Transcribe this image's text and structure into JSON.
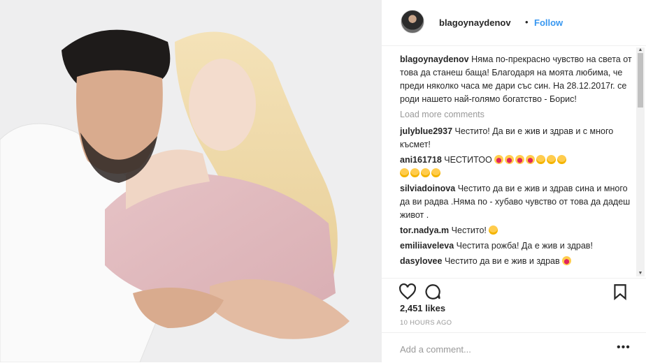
{
  "header": {
    "username": "blagoynaydenov",
    "separator": "•",
    "follow_label": "Follow"
  },
  "caption": {
    "username": "blagoynaydenov",
    "text": "Няма по-прекрасно чувство на света от това да станеш баща! Благодаря на моята любима, че преди няколко часа ме дари със син. На 28.12.2017г. се роди нашето най-голямо богатство - Борис!"
  },
  "load_more": "Load more comments",
  "comments": [
    {
      "username": "julyblue2937",
      "text": "Честито! Да ви е жив и здрав и с много късмет!"
    },
    {
      "username": "ani161718",
      "text": "ЧЕСТИТОО",
      "emoji": [
        "heart-eyes",
        "heart-eyes",
        "heart-eyes",
        "heart-eyes",
        "smiley",
        "smiley",
        "smiley",
        "smiley",
        "smiley",
        "smiley",
        "smiley"
      ]
    },
    {
      "username": "silviadoinova",
      "text": "Честито да ви е жив и здрав сина и много да ви радва .Няма по - хубаво чувство от това да дадеш живот ."
    },
    {
      "username": "tor.nadya.m",
      "text": "Честито!",
      "emoji": [
        "hugging"
      ]
    },
    {
      "username": "emiliiaveleva",
      "text": "Честита рожба! Да е жив и здрав!"
    },
    {
      "username": "dasylovee",
      "text": "Честито да ви е жив и здрав",
      "emoji": [
        "heart-eyes"
      ]
    }
  ],
  "likes": "2,451 likes",
  "timestamp": "10 HOURS AGO",
  "add_comment_placeholder": "Add a comment...",
  "more_options": "•••",
  "icons": {
    "like": "heart-outline-icon",
    "comment": "comment-bubble-icon",
    "save": "bookmark-icon"
  },
  "colors": {
    "link_blue": "#3897f0",
    "text": "#262626",
    "muted": "#999999"
  }
}
